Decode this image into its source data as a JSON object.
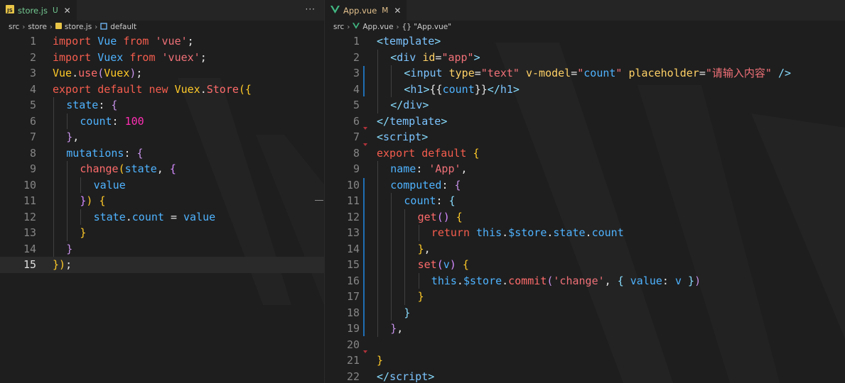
{
  "left": {
    "tab": {
      "icon": "js-file-icon",
      "filename": "store.js",
      "badge": "U",
      "close": "✕"
    },
    "more": "···",
    "breadcrumb": [
      "src",
      "store",
      "store.js",
      "default"
    ],
    "active_line": 15,
    "lines": [
      {
        "n": 1,
        "indent": 0,
        "t": [
          [
            "k",
            "import "
          ],
          [
            "v",
            "Vue "
          ],
          [
            "k",
            "from "
          ],
          [
            "s",
            "'vue'"
          ],
          [
            "w",
            ";"
          ]
        ]
      },
      {
        "n": 2,
        "indent": 0,
        "t": [
          [
            "k",
            "import "
          ],
          [
            "v",
            "Vuex "
          ],
          [
            "k",
            "from "
          ],
          [
            "s",
            "'vuex'"
          ],
          [
            "w",
            ";"
          ]
        ]
      },
      {
        "n": 3,
        "indent": 0,
        "t": [
          [
            "c",
            "Vue"
          ],
          [
            "w",
            "."
          ],
          [
            "f",
            "use"
          ],
          [
            "m",
            "("
          ],
          [
            "c",
            "Vuex"
          ],
          [
            "m",
            ")"
          ],
          [
            "w",
            ";"
          ]
        ]
      },
      {
        "n": 4,
        "indent": 0,
        "t": [
          [
            "k",
            "export default new "
          ],
          [
            "c",
            "Vuex"
          ],
          [
            "w",
            "."
          ],
          [
            "f",
            "Store"
          ],
          [
            "c",
            "({"
          ]
        ]
      },
      {
        "n": 5,
        "indent": 1,
        "t": [
          [
            "v",
            "state"
          ],
          [
            "w",
            ": "
          ],
          [
            "m",
            "{"
          ]
        ]
      },
      {
        "n": 6,
        "indent": 2,
        "t": [
          [
            "v",
            "count"
          ],
          [
            "w",
            ": "
          ],
          [
            "n",
            "100"
          ]
        ]
      },
      {
        "n": 7,
        "indent": 1,
        "t": [
          [
            "m",
            "}"
          ],
          [
            "w",
            ","
          ]
        ]
      },
      {
        "n": 8,
        "indent": 1,
        "t": [
          [
            "v",
            "mutations"
          ],
          [
            "w",
            ": "
          ],
          [
            "m",
            "{"
          ]
        ]
      },
      {
        "n": 9,
        "indent": 2,
        "t": [
          [
            "f",
            "change"
          ],
          [
            "c",
            "("
          ],
          [
            "v",
            "state"
          ],
          [
            "w",
            ", "
          ],
          [
            "pk",
            "{"
          ]
        ]
      },
      {
        "n": 10,
        "indent": 3,
        "t": [
          [
            "v",
            "value"
          ]
        ]
      },
      {
        "n": 11,
        "indent": 2,
        "t": [
          [
            "pk",
            "}"
          ],
          [
            "c",
            ")"
          ],
          [
            "w",
            " "
          ],
          [
            "c",
            "{"
          ]
        ]
      },
      {
        "n": 12,
        "indent": 3,
        "t": [
          [
            "v",
            "state"
          ],
          [
            "w",
            "."
          ],
          [
            "v",
            "count"
          ],
          [
            "w",
            " = "
          ],
          [
            "v",
            "value"
          ]
        ]
      },
      {
        "n": 13,
        "indent": 2,
        "t": [
          [
            "c",
            "}"
          ]
        ]
      },
      {
        "n": 14,
        "indent": 1,
        "t": [
          [
            "m",
            "}"
          ]
        ]
      },
      {
        "n": 15,
        "indent": 0,
        "t": [
          [
            "c",
            "})"
          ],
          [
            "w",
            ";"
          ]
        ]
      }
    ]
  },
  "right": {
    "tab": {
      "icon": "vue-file-icon",
      "filename": "App.vue",
      "badge": "M",
      "close": "✕"
    },
    "breadcrumb": [
      "src",
      "App.vue",
      "{} \"App.vue\""
    ],
    "lines": [
      {
        "n": 1,
        "indent": 0,
        "t": [
          [
            "p",
            "<"
          ],
          [
            "tg",
            "template"
          ],
          [
            "p",
            ">"
          ]
        ]
      },
      {
        "n": 2,
        "indent": 1,
        "t": [
          [
            "p",
            "<"
          ],
          [
            "tg",
            "div "
          ],
          [
            "at",
            "id"
          ],
          [
            "w",
            "="
          ],
          [
            "s",
            "\"app\""
          ],
          [
            "p",
            ">"
          ]
        ]
      },
      {
        "n": 3,
        "indent": 2,
        "t": [
          [
            "p",
            "<"
          ],
          [
            "tg",
            "input "
          ],
          [
            "at",
            "type"
          ],
          [
            "w",
            "="
          ],
          [
            "s",
            "\"text\" "
          ],
          [
            "at",
            "v-model"
          ],
          [
            "w",
            "="
          ],
          [
            "s",
            "\""
          ],
          [
            "v",
            "count"
          ],
          [
            "s",
            "\" "
          ],
          [
            "at",
            "placeholder"
          ],
          [
            "w",
            "="
          ],
          [
            "s",
            "\"请输入内容\" "
          ],
          [
            "p",
            "/>"
          ]
        ]
      },
      {
        "n": 4,
        "indent": 2,
        "t": [
          [
            "p",
            "<"
          ],
          [
            "tg",
            "h1"
          ],
          [
            "p",
            ">"
          ],
          [
            "w",
            "{{"
          ],
          [
            "v",
            "count"
          ],
          [
            "w",
            "}}"
          ],
          [
            "p",
            "</"
          ],
          [
            "tg",
            "h1"
          ],
          [
            "p",
            ">"
          ]
        ]
      },
      {
        "n": 5,
        "indent": 1,
        "t": [
          [
            "p",
            "</"
          ],
          [
            "tg",
            "div"
          ],
          [
            "p",
            ">"
          ]
        ]
      },
      {
        "n": 6,
        "indent": 0,
        "t": [
          [
            "p",
            "</"
          ],
          [
            "tg",
            "template"
          ],
          [
            "p",
            ">"
          ]
        ]
      },
      {
        "n": 7,
        "indent": 0,
        "t": [
          [
            "p",
            "<"
          ],
          [
            "tg",
            "script"
          ],
          [
            "p",
            ">"
          ]
        ]
      },
      {
        "n": 8,
        "indent": 0,
        "t": [
          [
            "k",
            "export default "
          ],
          [
            "c",
            "{"
          ]
        ]
      },
      {
        "n": 9,
        "indent": 1,
        "t": [
          [
            "v",
            "name"
          ],
          [
            "w",
            ": "
          ],
          [
            "s",
            "'App'"
          ],
          [
            "w",
            ","
          ]
        ]
      },
      {
        "n": 10,
        "indent": 1,
        "t": [
          [
            "v",
            "computed"
          ],
          [
            "w",
            ": "
          ],
          [
            "m",
            "{"
          ]
        ]
      },
      {
        "n": 11,
        "indent": 2,
        "t": [
          [
            "v",
            "count"
          ],
          [
            "w",
            ": "
          ],
          [
            "p",
            "{"
          ]
        ]
      },
      {
        "n": 12,
        "indent": 3,
        "t": [
          [
            "f",
            "get"
          ],
          [
            "pk",
            "()"
          ],
          [
            "w",
            " "
          ],
          [
            "c",
            "{"
          ]
        ]
      },
      {
        "n": 13,
        "indent": 4,
        "t": [
          [
            "k",
            "return "
          ],
          [
            "v",
            "this"
          ],
          [
            "w",
            "."
          ],
          [
            "v",
            "$store"
          ],
          [
            "w",
            "."
          ],
          [
            "v",
            "state"
          ],
          [
            "w",
            "."
          ],
          [
            "v",
            "count"
          ]
        ]
      },
      {
        "n": 14,
        "indent": 3,
        "t": [
          [
            "c",
            "}"
          ],
          [
            "w",
            ","
          ]
        ]
      },
      {
        "n": 15,
        "indent": 3,
        "t": [
          [
            "f",
            "set"
          ],
          [
            "pk",
            "("
          ],
          [
            "v",
            "v"
          ],
          [
            "pk",
            ")"
          ],
          [
            "w",
            " "
          ],
          [
            "c",
            "{"
          ]
        ]
      },
      {
        "n": 16,
        "indent": 4,
        "t": [
          [
            "v",
            "this"
          ],
          [
            "w",
            "."
          ],
          [
            "v",
            "$store"
          ],
          [
            "w",
            "."
          ],
          [
            "f",
            "commit"
          ],
          [
            "m",
            "("
          ],
          [
            "s",
            "'change'"
          ],
          [
            "w",
            ", "
          ],
          [
            "p",
            "{ "
          ],
          [
            "v",
            "value"
          ],
          [
            "w",
            ": "
          ],
          [
            "v",
            "v "
          ],
          [
            "p",
            "}"
          ],
          [
            "m",
            ")"
          ]
        ]
      },
      {
        "n": 17,
        "indent": 3,
        "t": [
          [
            "c",
            "}"
          ]
        ]
      },
      {
        "n": 18,
        "indent": 2,
        "t": [
          [
            "p",
            "}"
          ]
        ]
      },
      {
        "n": 19,
        "indent": 1,
        "t": [
          [
            "m",
            "}"
          ],
          [
            "w",
            ","
          ]
        ]
      },
      {
        "n": 20,
        "indent": 0,
        "t": []
      },
      {
        "n": 21,
        "indent": 0,
        "t": [
          [
            "c",
            "}"
          ]
        ]
      },
      {
        "n": 22,
        "indent": 0,
        "t": [
          [
            "p",
            "</"
          ],
          [
            "tg",
            "script"
          ],
          [
            "p",
            ">"
          ]
        ]
      }
    ]
  },
  "colors": {
    "background": "#1e1e1e",
    "tabbar": "#252526",
    "js_icon": "#e8c547",
    "vue_icon": "#41b883",
    "untracked_badge": "#73c991",
    "modified_badge": "#e2c08d",
    "gutter_change": "#1f6fb5",
    "fold_marker": "#b0323a"
  }
}
